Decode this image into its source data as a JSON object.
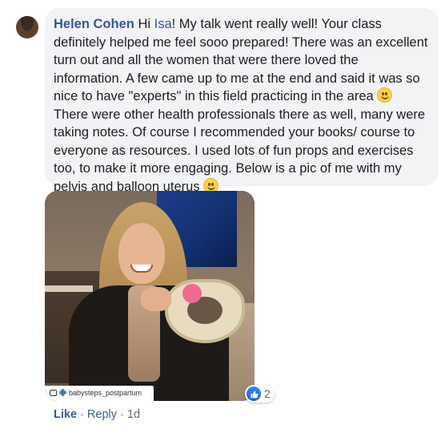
{
  "comment": {
    "author": "Helen Cohen",
    "text_part1": " Hi ",
    "mention": "Isa",
    "text_part2": "! My talk went really well! Your class definitely helped me feel sooo prepared! There was an excellent turn out and all the women that were there loved the information. A few came up to me at the end and said it was so nice to have \"experts\" in this field practicing in the area ",
    "text_part3": " There were other health professionals there as well, many were taking notes. Of course I recommended your books/ course to everyone as resources. I used lots of fun props and exercises too, to make it more engaging. Below is a pic of me with my pelvis and balloon uterus ",
    "emoji": "smile-emoji"
  },
  "photo": {
    "watermark": "babysteps_postpartum"
  },
  "reactions": {
    "icon": "thumbs-up-icon",
    "count": "2",
    "color": "#1a5fd6"
  },
  "actions": {
    "like_label": "Like",
    "separator1": " · ",
    "reply_label": "Reply",
    "separator2": " · ",
    "time": "1d"
  },
  "colors": {
    "link": "#385898",
    "bubble": "#f2f3f5",
    "text": "#1c1e21",
    "meta": "#606770"
  }
}
